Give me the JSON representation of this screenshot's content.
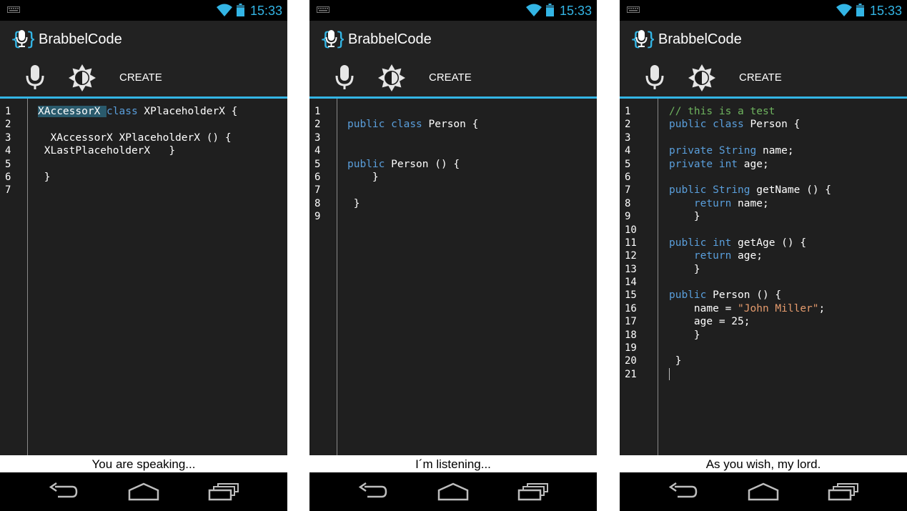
{
  "status_bar": {
    "time": "15:33"
  },
  "app": {
    "title": "BrabbelCode"
  },
  "toolbar": {
    "create_label": "CREATE"
  },
  "colors": {
    "accent": "#33b5e5",
    "keyword": "#5a9fdc",
    "comment": "#6fb45f",
    "string": "#e59b6d"
  },
  "icons": [
    "keyboard-icon",
    "wifi-icon",
    "battery-icon",
    "microphone-icon",
    "brightness-icon",
    "back-icon",
    "home-icon",
    "recent-apps-icon"
  ],
  "screens": [
    {
      "line_numbers": [
        "1",
        "2",
        "3",
        "4",
        "5",
        "6",
        "7"
      ],
      "status_message": "You are speaking..."
    },
    {
      "line_numbers": [
        "1",
        "2",
        "3",
        "4",
        "5",
        "6",
        "7",
        "8",
        "9"
      ],
      "status_message": "I´m listening..."
    },
    {
      "line_numbers": [
        "1",
        "2",
        "3",
        "4",
        "5",
        "6",
        "7",
        "8",
        "9",
        "10",
        "11",
        "12",
        "13",
        "14",
        "15",
        "16",
        "17",
        "18",
        "19",
        "20",
        "21"
      ],
      "status_message": "As you wish, my lord."
    }
  ],
  "code": {
    "s1": {
      "l1_sel": "XAccessorX ",
      "l1_kw": "class",
      "l1_rest": " XPlaceholderX {",
      "l3": "  XAccessorX XPlaceholderX () {",
      "l4": " XLastPlaceholderX   }",
      "l6": " }"
    },
    "s2": {
      "l2_kw1": "public",
      "l2_kw2": "class",
      "l2_rest": " Person {",
      "l5_kw": "public",
      "l5_rest": " Person () {",
      "l6": "    }",
      "l8": " }"
    },
    "s3": {
      "l1": "// this is a test",
      "l2_kw1": "public",
      "l2_kw2": "class",
      "l2_rest": " Person {",
      "l4_kw1": "private",
      "l4_kw2": "String",
      "l4_rest": " name;",
      "l5_kw1": "private",
      "l5_kw2": "int",
      "l5_rest": " age;",
      "l7_kw1": "public",
      "l7_kw2": "String",
      "l7_rest": " getName () {",
      "l8_kw": "return",
      "l8_rest": " name;",
      "l9": "    }",
      "l11_kw1": "public",
      "l11_kw2": "int",
      "l11_rest": " getAge () {",
      "l12_kw": "return",
      "l12_rest": " age;",
      "l13": "    }",
      "l15_kw": "public",
      "l15_rest": " Person () {",
      "l16_a": "    name = ",
      "l16_str": "\"John Miller\"",
      "l16_b": ";",
      "l17": "    age = 25;",
      "l18": "    }",
      "l20": " }"
    }
  }
}
